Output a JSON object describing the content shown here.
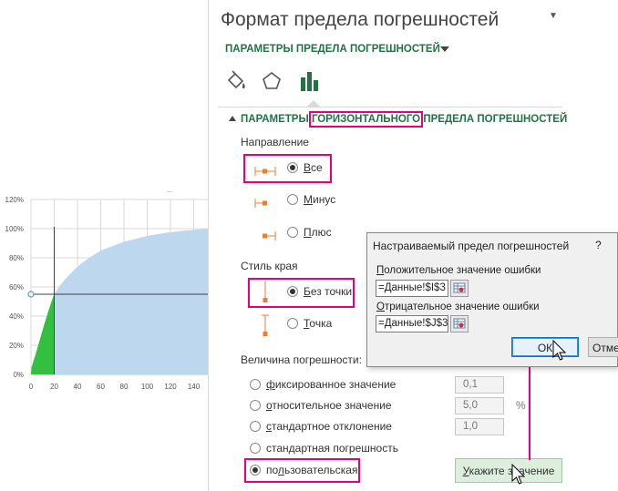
{
  "chart_data": {
    "type": "area",
    "y_ticks": [
      "0%",
      "20%",
      "40%",
      "60%",
      "80%",
      "100%",
      "120%"
    ],
    "x_ticks": [
      "0",
      "20",
      "40",
      "60",
      "80",
      "100",
      "120",
      "140"
    ],
    "ylim": [
      0,
      1.2
    ],
    "xlim": [
      0,
      160
    ],
    "grid": true,
    "marker_value": {
      "x": 20,
      "y": 0.55
    },
    "series": [
      {
        "color": "#33bf3f",
        "points": [
          [
            0,
            0
          ],
          [
            0.5,
            0.05
          ],
          [
            4,
            0.14
          ],
          [
            8,
            0.25
          ],
          [
            12,
            0.36
          ],
          [
            16,
            0.46
          ],
          [
            19,
            0.53
          ],
          [
            20,
            0.55
          ],
          [
            20,
            0
          ]
        ]
      },
      {
        "color": "#bdd7ee",
        "points": [
          [
            20,
            0
          ],
          [
            20,
            0.55
          ],
          [
            25,
            0.61
          ],
          [
            30,
            0.66
          ],
          [
            40,
            0.74
          ],
          [
            50,
            0.8
          ],
          [
            60,
            0.85
          ],
          [
            70,
            0.88
          ],
          [
            80,
            0.91
          ],
          [
            90,
            0.93
          ],
          [
            100,
            0.95
          ],
          [
            115,
            0.97
          ],
          [
            130,
            0.985
          ],
          [
            145,
            0.995
          ],
          [
            160,
            1.0
          ],
          [
            160,
            0
          ]
        ]
      }
    ],
    "colors": {
      "green": "#33bf3f",
      "blue": "#bdd7ee",
      "crosshair": "#404040",
      "marker": "#5b9bd5"
    }
  },
  "pane": {
    "title": "Формат предела погрешностей",
    "close_glyph": "▼",
    "options_label": "ПАРАМЕТРЫ ПРЕДЕЛА ПОГРЕШНОСТЕЙ",
    "icons": [
      "fill-line-icon",
      "effects-icon",
      "error-bar-options-icon"
    ],
    "section": {
      "prefix": "ПАРАМЕТРЫ ",
      "highlight": "ГОРИЗОНТАЛЬНОГО",
      "suffix": " ПРЕДЕЛА ПОГРЕШНОСТЕЙ"
    },
    "direction": {
      "label": "Направление",
      "options": [
        {
          "u": "В",
          "rest": "се",
          "checked": true
        },
        {
          "u": "М",
          "rest": "инус",
          "checked": false
        },
        {
          "u": "П",
          "rest": "люс",
          "checked": false
        }
      ]
    },
    "end_style": {
      "label": "Стиль края",
      "options": [
        {
          "u": "Б",
          "rest": "ез точки",
          "checked": true
        },
        {
          "u": "Т",
          "rest": "очка",
          "checked": false
        }
      ]
    },
    "amount": {
      "label": "Величина погрешности:",
      "options": [
        {
          "u": "ф",
          "rest": "иксированное значение",
          "checked": false,
          "value": "0,1"
        },
        {
          "u": "о",
          "rest": "тносительное значение",
          "checked": false,
          "value": "5,0",
          "unit": "%"
        },
        {
          "u": "с",
          "rest": "тандартное отклонение",
          "checked": false,
          "value": "1,0"
        },
        {
          "u": "",
          "rest": "стандартная погрешность",
          "checked": false
        },
        {
          "pre": "по",
          "u": "л",
          "rest": "ьзовательская",
          "checked": true
        }
      ],
      "specify_button": {
        "u": "У",
        "rest": "кажите значение"
      }
    },
    "accent_color": "#217346",
    "highlight_color": "#e6007e"
  },
  "dialog": {
    "title": "Настраиваемый предел погрешностей",
    "help": "?",
    "positive": {
      "u": "П",
      "rest": "оложительное значение ошибки",
      "value": "=Данные!$I$3"
    },
    "negative": {
      "u": "О",
      "rest": "трицательное значение ошибки",
      "value": "=Данные!$J$3"
    },
    "ok_label": "ОК",
    "cancel_label": "Отмена"
  }
}
